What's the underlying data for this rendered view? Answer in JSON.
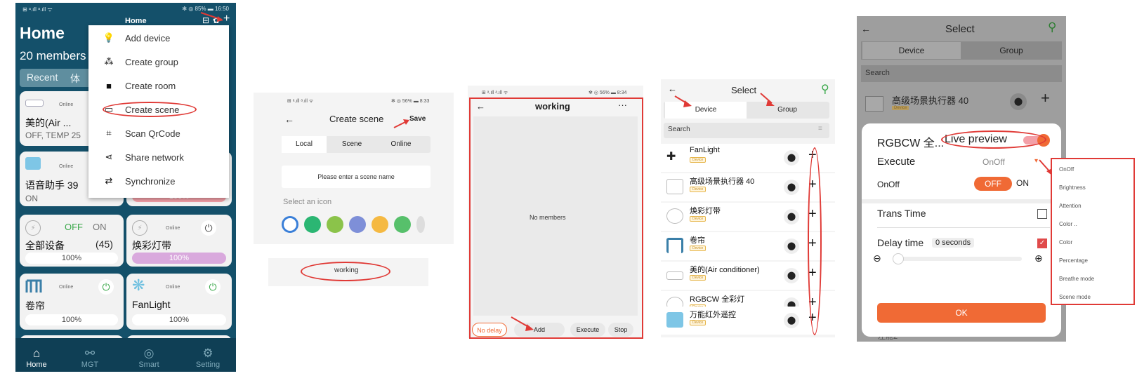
{
  "colors": {
    "teal": "#14506a",
    "accent_red": "#e03a36",
    "orange": "#f06a35",
    "green": "#3aa84a",
    "purple": "#d9a9dd",
    "pink": "#f3a0a8"
  },
  "panel1": {
    "status_left": "⊞ ᵃ.ıll ᵃ.ıll ᯤ",
    "status_right": "✻ ◎ 85% ▬ 16:50",
    "title": "Home",
    "members": "20 members",
    "tabs": [
      "Recent",
      "体"
    ],
    "cards": [
      {
        "name": "美的(Air ...",
        "status": "Online",
        "sub": "OFF, TEMP 25"
      },
      {
        "name": "语音助手 39",
        "status": "Online",
        "sub": "ON",
        "right_bar": "100%"
      },
      {
        "name": "全部设备",
        "count": "(45)",
        "off": "OFF",
        "on": "ON",
        "bar": "100%"
      },
      {
        "name": "焕彩灯带",
        "status": "Online",
        "bar": "100%"
      },
      {
        "name": "卷帘",
        "status": "Online",
        "bar": "100%"
      },
      {
        "name": "FanLight",
        "status": "Online",
        "bar": "100%"
      }
    ],
    "nav": [
      {
        "label": "Home",
        "icon": "home-icon"
      },
      {
        "label": "MGT",
        "icon": "share-icon"
      },
      {
        "label": "Smart",
        "icon": "smart-icon"
      },
      {
        "label": "Setting",
        "icon": "gear-icon"
      }
    ]
  },
  "menu": {
    "header": "Home",
    "items": [
      "Add device",
      "Create group",
      "Create room",
      "Create scene",
      "Scan QrCode",
      "Share network",
      "Synchronize"
    ]
  },
  "panel2": {
    "status_right": "✻ ◎ 56% ▬ 8:33",
    "title": "Create scene",
    "save": "Save",
    "tabs": [
      "Local",
      "Scene",
      "Online"
    ],
    "name_placeholder": "Please enter a scene name",
    "select_icon": "Select an icon",
    "typed_name": "working"
  },
  "panel3": {
    "status_right": "✻ ◎ 56% ▬ 8:34",
    "title": "working",
    "more": "···",
    "empty": "No members",
    "buttons": [
      "No delay",
      "Add",
      "Execute",
      "Stop"
    ]
  },
  "panel4": {
    "title": "Select",
    "tabs": [
      "Device",
      "Group"
    ],
    "search": "Search",
    "badge": "Device",
    "rows": [
      "FanLight",
      "高级场景执行器 40",
      "焕彩灯带",
      "卷帘",
      "美的(Air conditioner)",
      "RGBCW 全彩灯",
      "万能红外遥控"
    ]
  },
  "panel5": {
    "title": "Select",
    "tabs": [
      "Device",
      "Group"
    ],
    "search": "Search",
    "device": "高级场景执行器 40",
    "badge": "Device",
    "sheet_title": "RGBCW 全...",
    "live_preview": "Live preview",
    "execute": "Execute",
    "execute_value": "OnOff",
    "onoff": "OnOff",
    "off": "OFF",
    "on": "ON",
    "trans_time": "Trans Time",
    "delay_time": "Delay time",
    "delay_value": "0 seconds",
    "ok": "OK",
    "below_text": "左舱2",
    "dropdown": [
      "OnOff",
      "Brightness",
      "Attention",
      "Color ..",
      "Color",
      "Percentage",
      "Breathe mode",
      "Scene mode"
    ]
  }
}
